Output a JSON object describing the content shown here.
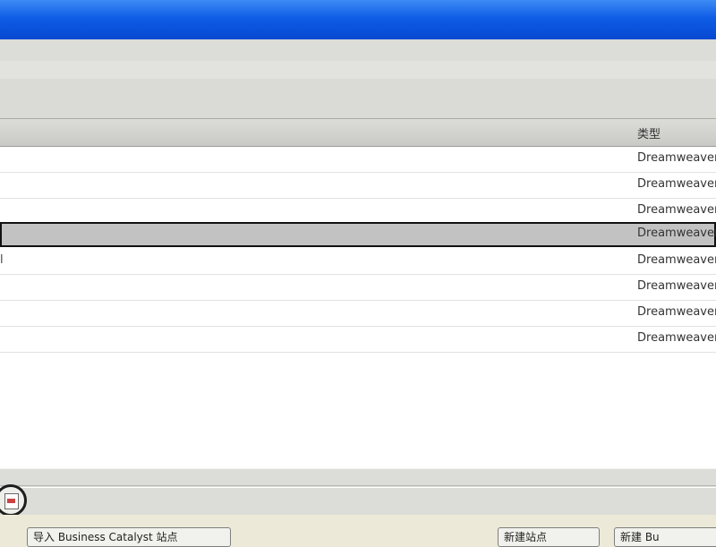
{
  "list": {
    "columns": {
      "type": "类型"
    },
    "rows": [
      {
        "name": "",
        "type": "Dreamweaver"
      },
      {
        "name": "",
        "type": "Dreamweaver"
      },
      {
        "name": "",
        "type": "Dreamweaver"
      },
      {
        "name": "",
        "type": "Dreamweaver",
        "selected": true
      },
      {
        "name": "l",
        "type": "Dreamweaver"
      },
      {
        "name": "",
        "type": "Dreamweaver"
      },
      {
        "name": "",
        "type": "Dreamweaver"
      },
      {
        "name": "",
        "type": "Dreamweaver"
      }
    ]
  },
  "buttons": {
    "import_label": "导入 Business Catalyst 站点",
    "new_site_label": "新建站点",
    "new_label": "新建 Bu"
  },
  "icons": {
    "status_icon": "document-icon"
  },
  "colors": {
    "titlebar": "#0f5de6",
    "selected_row": "#c2c2c2"
  }
}
